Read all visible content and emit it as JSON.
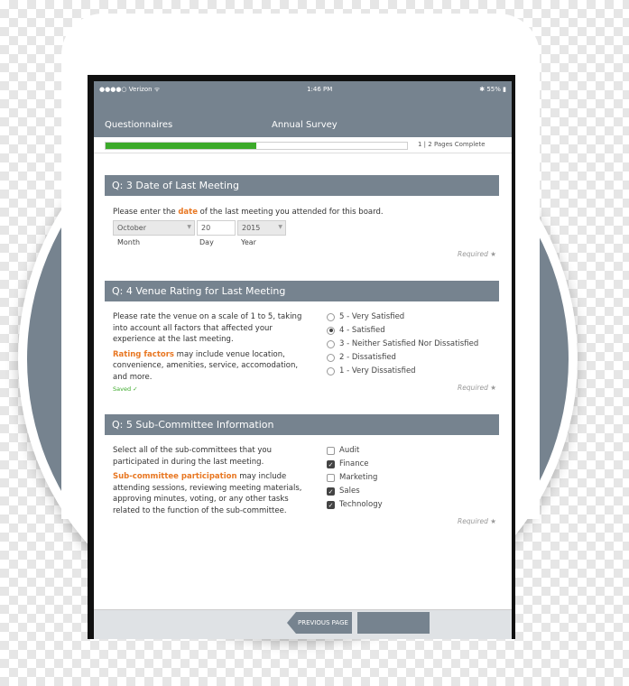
{
  "status_bar": {
    "carrier": "●●●●○ Verizon  ᯤ",
    "time": "1:46 PM",
    "battery": "✱ 55% ▮"
  },
  "nav": {
    "back_label": "Questionnaires",
    "title": "Annual Survey"
  },
  "progress": {
    "fraction": 0.5,
    "label": "1 | 2   Pages Complete"
  },
  "q3": {
    "header": "Q: 3  Date of Last Meeting",
    "prompt_pre": "Please enter the ",
    "prompt_em": "date",
    "prompt_post": " of the last meeting you attended for this board.",
    "month_value": "October",
    "day_value": "20",
    "year_value": "2015",
    "month_label": "Month",
    "day_label": "Day",
    "year_label": "Year",
    "required": "Required ★"
  },
  "q4": {
    "header": "Q: 4  Venue Rating for Last Meeting",
    "p1": [
      "Please rate the venue on a scale of 1 to 5, taking",
      "into account all factors that affected your",
      "experience at the last meeting."
    ],
    "p2_em": "Rating factors",
    "p2": [
      " may include venue location,",
      "convenience, amenities, service, accomodation,",
      "and more."
    ],
    "saved": "Saved ✓",
    "options": [
      {
        "label": "5 - Very Satisfied",
        "selected": false
      },
      {
        "label": "4 - Satisfied",
        "selected": true
      },
      {
        "label": "3 - Neither Satisfied Nor Dissatisfied",
        "selected": false
      },
      {
        "label": "2 - Dissatisfied",
        "selected": false
      },
      {
        "label": "1 - Very Dissatisfied",
        "selected": false
      }
    ],
    "required": "Required ★"
  },
  "q5": {
    "header": "Q: 5  Sub-Committee Information",
    "p1": [
      "Select all of the sub-committees that you",
      "participated in during the last meeting."
    ],
    "p2_em": "Sub-committee participation",
    "p2": [
      " may include",
      "attending sessions, reviewing meeting materials,",
      "approving minutes, voting, or any other tasks",
      "related to the function of the sub-committee."
    ],
    "options": [
      {
        "label": "Audit",
        "checked": false
      },
      {
        "label": "Finance",
        "checked": true
      },
      {
        "label": "Marketing",
        "checked": false
      },
      {
        "label": "Sales",
        "checked": true
      },
      {
        "label": "Technology",
        "checked": true
      }
    ],
    "required": "Required ★"
  },
  "footer": {
    "prev_label": "PREVIOUS PAGE"
  },
  "colors": {
    "header_gray": "#76838f",
    "accent_orange": "#e87722",
    "progress_green": "#3caa2a"
  }
}
